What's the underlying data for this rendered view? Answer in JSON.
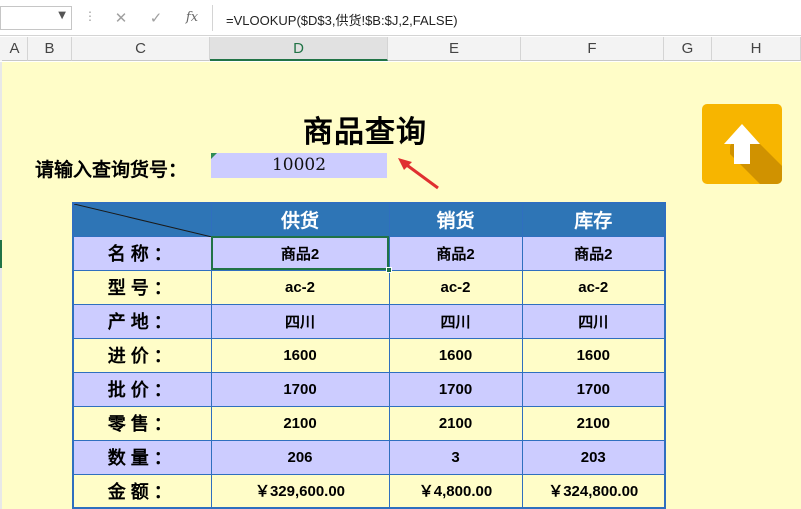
{
  "formula_bar": {
    "name_box": "",
    "cancel_icon": "✕",
    "enter_icon": "✓",
    "function_icon": "fx",
    "formula": "=VLOOKUP($D$3,供货!$B:$J,2,FALSE)"
  },
  "columns": [
    "A",
    "B",
    "C",
    "D",
    "E",
    "F",
    "G",
    "H"
  ],
  "sheet": {
    "title": "商品查询",
    "prompt": "请输入查询货号：",
    "input_value": "10002"
  },
  "table": {
    "headers": [
      "供货",
      "销货",
      "库存"
    ],
    "rows": [
      {
        "label": "名称：",
        "values": [
          "商品2",
          "商品2",
          "商品2"
        ]
      },
      {
        "label": "型号：",
        "values": [
          "ac-2",
          "ac-2",
          "ac-2"
        ]
      },
      {
        "label": "产地：",
        "values": [
          "四川",
          "四川",
          "四川"
        ]
      },
      {
        "label": "进价：",
        "values": [
          "1600",
          "1600",
          "1600"
        ]
      },
      {
        "label": "批价：",
        "values": [
          "1700",
          "1700",
          "1700"
        ]
      },
      {
        "label": "零售：",
        "values": [
          "2100",
          "2100",
          "2100"
        ]
      },
      {
        "label": "数量：",
        "values": [
          "206",
          "3",
          "203"
        ]
      },
      {
        "label": "金额：",
        "values": [
          "￥329,600.00",
          "￥4,800.00",
          "￥324,800.00"
        ]
      }
    ]
  },
  "colors": {
    "sheet_bg": "#fffdc8",
    "header_blue": "#2e75b6",
    "row_lavender": "#ccccff",
    "accent_green": "#217346",
    "arrow_red": "#e03030",
    "icon_orange": "#f7b500"
  },
  "icons": {
    "upload": "up-arrow-icon",
    "pointer": "red-arrow-icon"
  }
}
